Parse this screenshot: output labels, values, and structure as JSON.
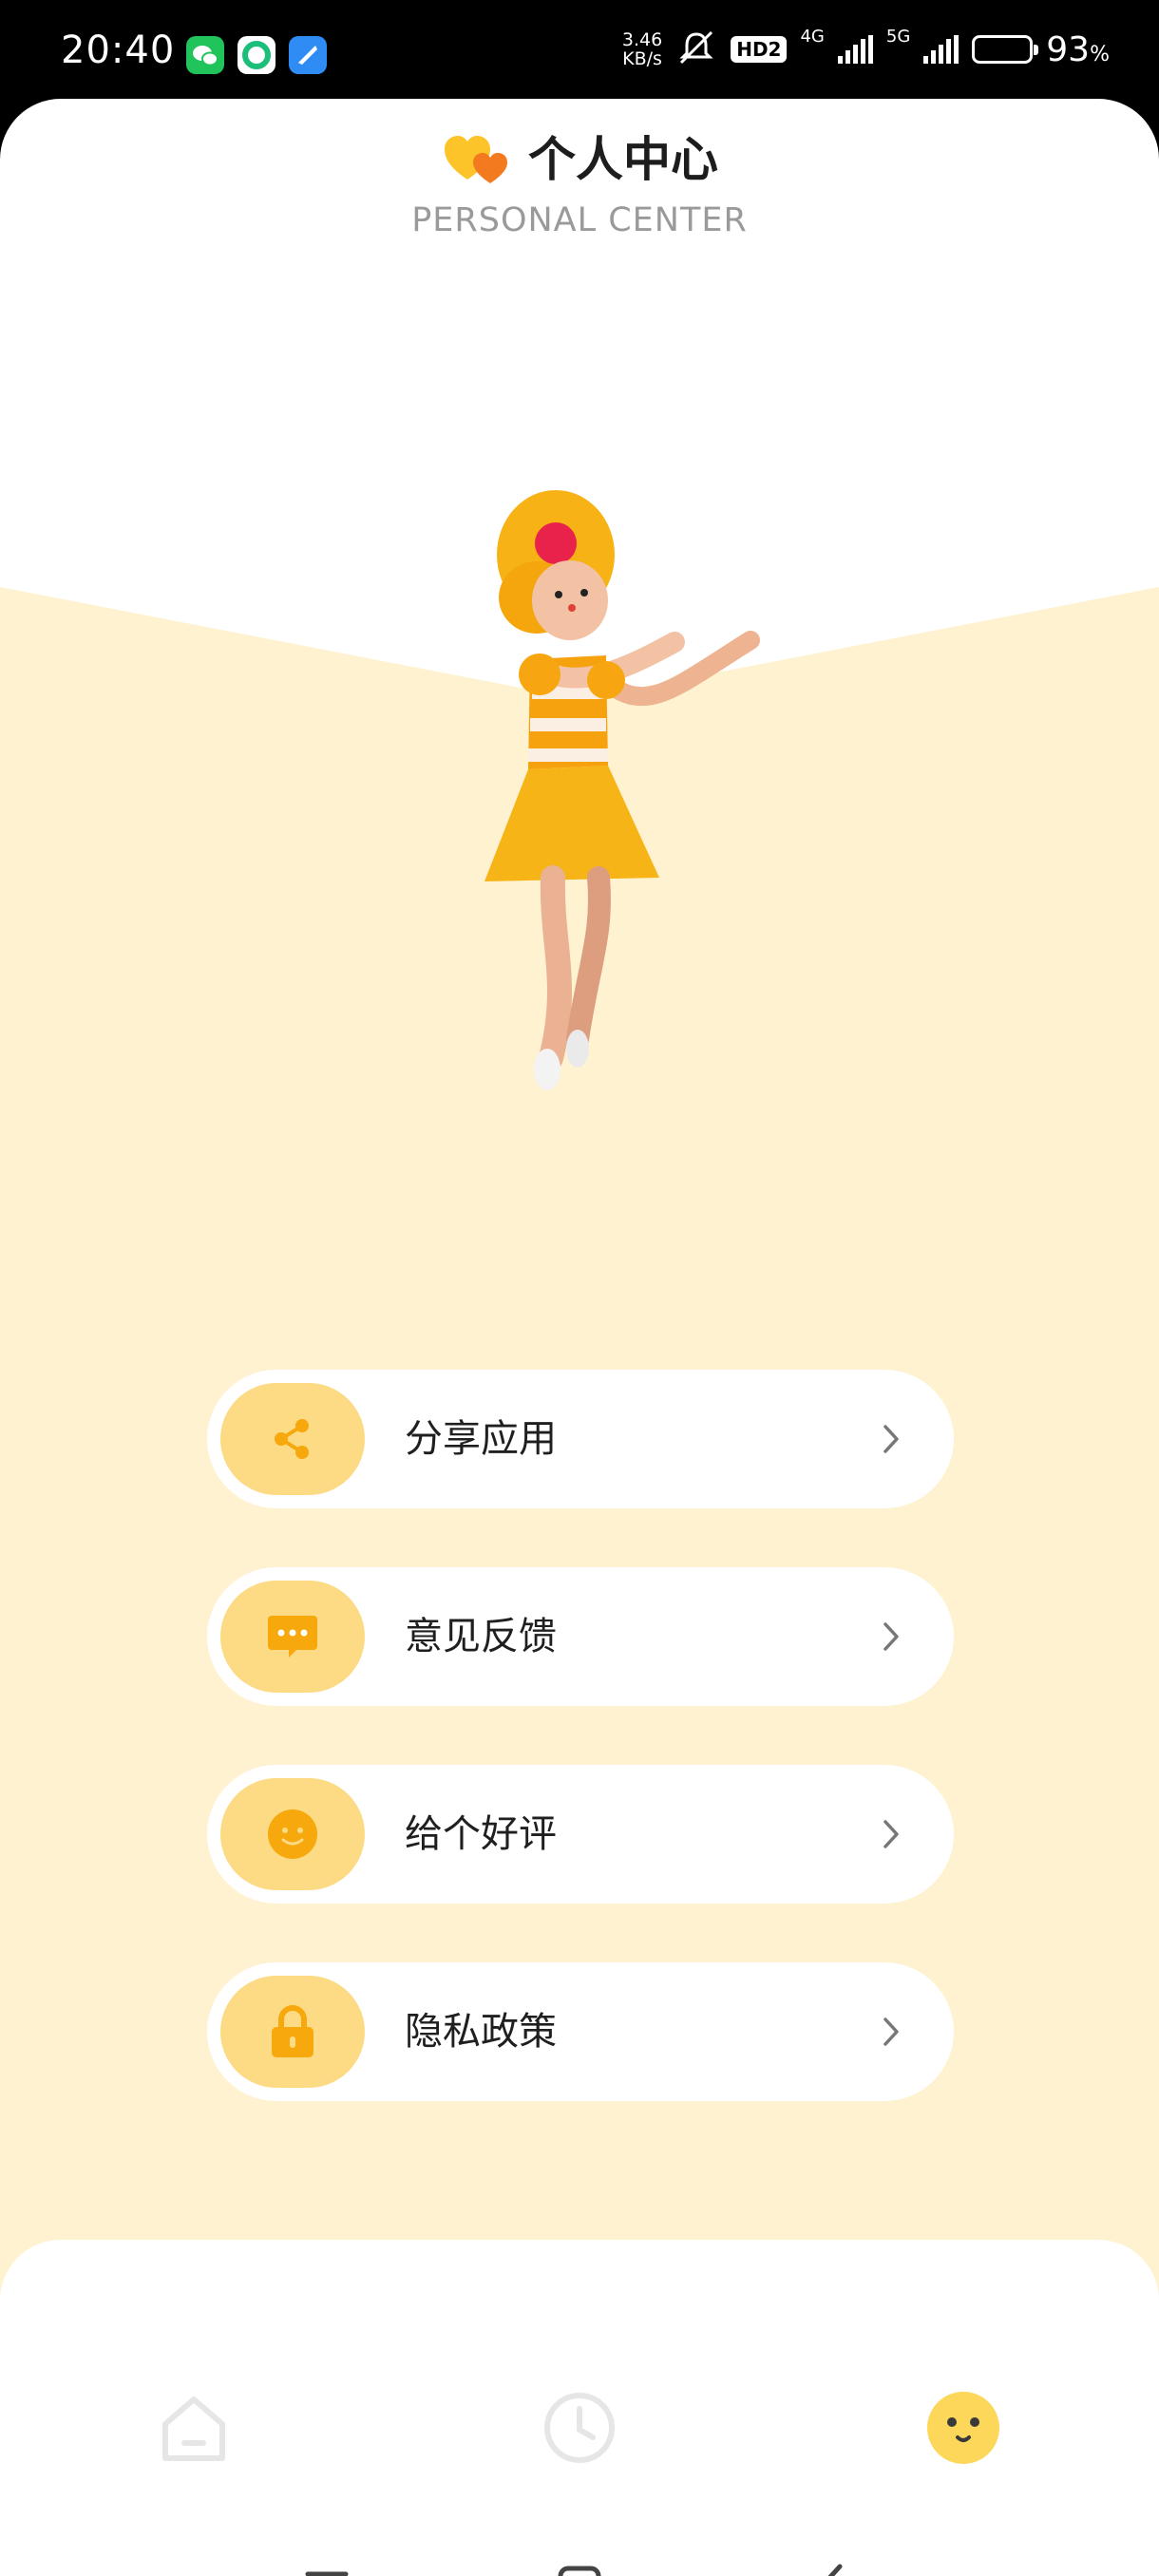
{
  "status_bar": {
    "time": "20:40",
    "net_speed_value": "3.46",
    "net_speed_unit": "KB/s",
    "hd_label": "HD2",
    "net_4g": "4G",
    "net_5g": "5G",
    "battery_percent": "93",
    "battery_unit": "%",
    "app_icons": [
      "wechat-icon",
      "chat-app-icon",
      "browser-app-icon"
    ]
  },
  "header": {
    "title": "个人中心",
    "subtitle": "PERSONAL CENTER"
  },
  "menu": {
    "items": [
      {
        "label": "分享应用",
        "icon": "share-icon"
      },
      {
        "label": "意见反馈",
        "icon": "feedback-icon"
      },
      {
        "label": "给个好评",
        "icon": "smile-icon"
      },
      {
        "label": "隐私政策",
        "icon": "lock-icon"
      }
    ]
  },
  "bottom_nav": {
    "tabs": [
      {
        "icon": "home-icon",
        "active": false
      },
      {
        "icon": "clock-icon",
        "active": false
      },
      {
        "icon": "profile-face-icon",
        "active": true
      }
    ]
  },
  "colors": {
    "accent": "#fdd75a",
    "pill": "#fddb84",
    "icon": "#f6a80c",
    "background_warm": "#fff2d0"
  }
}
